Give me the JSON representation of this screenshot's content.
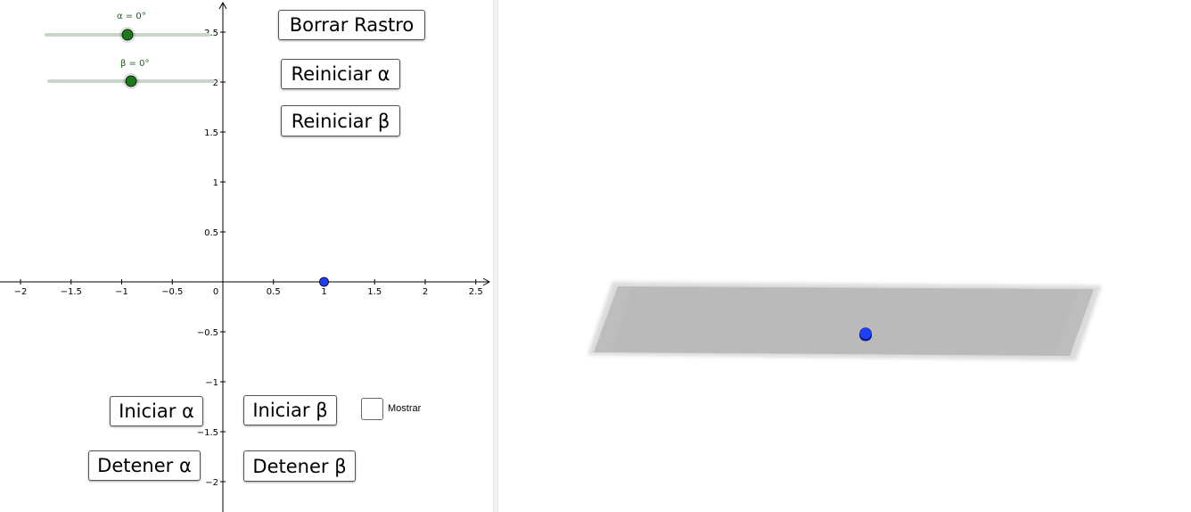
{
  "sliders": {
    "alpha": {
      "label": "α = 0°",
      "value_deg": 0,
      "position_fraction": 0.5
    },
    "beta": {
      "label": "β = 0°",
      "value_deg": 0,
      "position_fraction": 0.5
    }
  },
  "buttons": {
    "borrar_rastro": "Borrar Rastro",
    "reiniciar_alpha": "Reiniciar α",
    "reiniciar_beta": "Reiniciar β",
    "iniciar_alpha": "Iniciar α",
    "iniciar_beta": "Iniciar β",
    "detener_alpha": "Detener α",
    "detener_beta": "Detener β"
  },
  "checkbox": {
    "label": "Mostrar",
    "checked": false
  },
  "graphics2d": {
    "x_ticks": [
      "−2",
      "−1.5",
      "−1",
      "−0.5",
      "0",
      "0.5",
      "1",
      "1.5",
      "2",
      "2.5"
    ],
    "y_ticks": [
      "2.5",
      "2",
      "1.5",
      "1",
      "0.5",
      "−0.5",
      "−1",
      "−1.5",
      "−2"
    ],
    "point": {
      "x": 1,
      "y": 0,
      "color": "#1f3fff"
    }
  },
  "graphics3d": {
    "plane_color": "#bdbdbd",
    "point_color": "#1f3fff"
  },
  "colors": {
    "slider_point": "#1a7a1a",
    "slider_track": "#c9d6c9",
    "axis": "#000000"
  }
}
